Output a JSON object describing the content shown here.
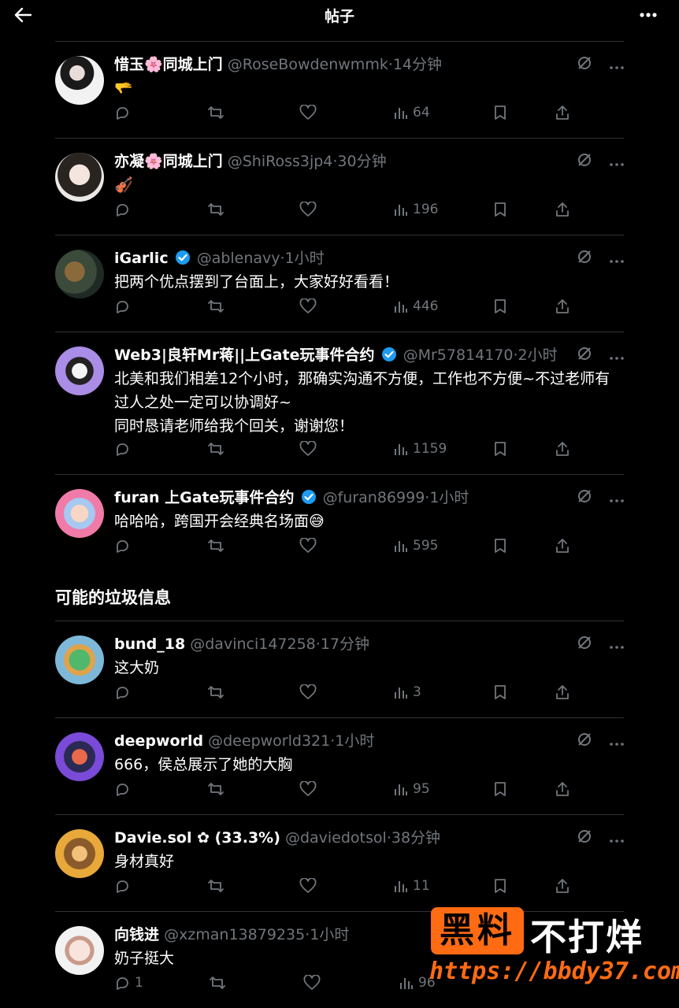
{
  "header": {
    "title": "帖子"
  },
  "section_title": "可能的垃圾信息",
  "posts": [
    {
      "name": "惜玉🌸同城上门",
      "handle": "@RoseBowdenwmmk",
      "time": "·14分钟",
      "text": "🫳",
      "verified": false,
      "replies": "",
      "views": "64"
    },
    {
      "name": "亦凝🌸同城上门",
      "handle": "@ShiRoss3jp4",
      "time": "·30分钟",
      "text": "🎻",
      "verified": false,
      "replies": "",
      "views": "196"
    },
    {
      "name": "iGarlic",
      "handle": "@ablenavy",
      "time": "·1小时",
      "text": "把两个优点摆到了台面上，大家好好看看！",
      "verified": true,
      "replies": "",
      "views": "446"
    },
    {
      "name": "Web3|良轩Mr蒋||上Gate玩事件合约",
      "handle": "@Mr57814170",
      "time": "·2小时",
      "text": "北美和我们相差12个小时，那确实沟通不方便，工作也不方便~不过老师有过人之处一定可以协调好~\n同时恳请老师给我个回关，谢谢您！",
      "verified": true,
      "replies": "",
      "views": "1159"
    },
    {
      "name": "furan 上Gate玩事件合约",
      "handle": "@furan86999",
      "time": "·1小时",
      "text": "哈哈哈，跨国开会经典名场面😅",
      "verified": true,
      "replies": "",
      "views": "595"
    },
    {
      "name": "bund_18",
      "handle": "@davinci147258",
      "time": "·17分钟",
      "text": "这大奶",
      "verified": false,
      "replies": "",
      "views": "3"
    },
    {
      "name": "deepworld",
      "handle": "@deepworld321",
      "time": "·1小时",
      "text": "666，侯总展示了她的大胸",
      "verified": false,
      "replies": "",
      "views": "95"
    },
    {
      "name": "Davie.sol ✿ (33.3%)",
      "handle": "@daviedotsol",
      "time": "·38分钟",
      "text": "身材真好",
      "verified": false,
      "replies": "",
      "views": "11"
    },
    {
      "name": "向钱进",
      "handle": "@xzman13879235",
      "time": "·1小时",
      "text": "奶子挺大",
      "verified": false,
      "replies": "1",
      "views": "96"
    }
  ],
  "watermark": {
    "box": "黑料",
    "right": "不打烊",
    "url": "https://bbdy37.com"
  },
  "colors": {
    "bg": "#000000",
    "text": "#e7e9ea",
    "muted": "#71767b",
    "border": "#2f3336",
    "verified": "#1d9bf0",
    "accent": "#ff6b13"
  },
  "icons": [
    "back-arrow-icon",
    "more-icon",
    "grok-icon",
    "reply-icon",
    "retweet-icon",
    "like-icon",
    "views-icon",
    "bookmark-icon",
    "share-icon",
    "verified-icon"
  ]
}
